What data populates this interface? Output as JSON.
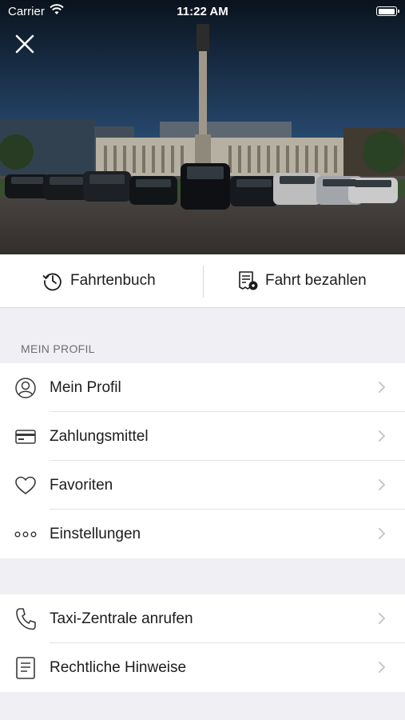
{
  "status_bar": {
    "carrier": "Carrier",
    "time": "11:22 AM"
  },
  "actions": {
    "history_label": "Fahrtenbuch",
    "pay_label": "Fahrt bezahlen"
  },
  "profile_section": {
    "header": "MEIN PROFIL",
    "items": [
      {
        "label": "Mein Profil",
        "icon": "person-circle-icon"
      },
      {
        "label": "Zahlungsmittel",
        "icon": "credit-card-icon"
      },
      {
        "label": "Favoriten",
        "icon": "heart-icon"
      },
      {
        "label": "Einstellungen",
        "icon": "more-dots-icon"
      }
    ]
  },
  "info_section": {
    "items": [
      {
        "label": "Taxi-Zentrale anrufen",
        "icon": "phone-icon"
      },
      {
        "label": "Rechtliche Hinweise",
        "icon": "document-icon"
      }
    ]
  },
  "colors": {
    "background": "#efeff4",
    "text": "#1c1c1e",
    "secondary": "#6d6d72",
    "chevron": "#c7c7cc"
  }
}
